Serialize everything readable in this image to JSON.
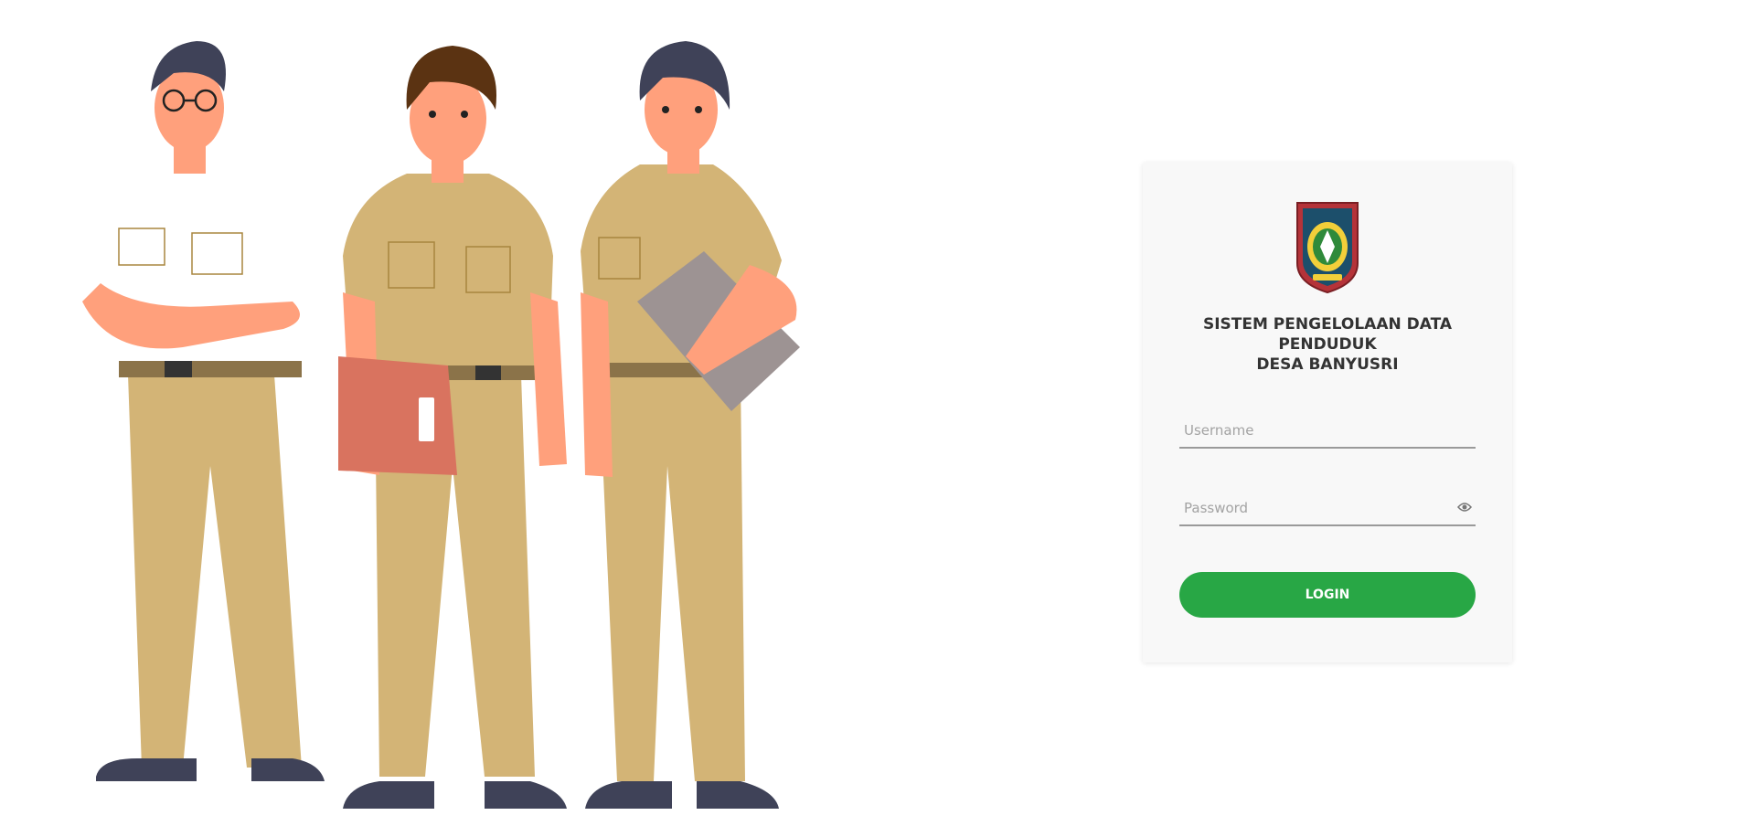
{
  "illustration": {
    "description_icon": "three-civil-servants-illustration"
  },
  "login": {
    "logo_icon": "village-crest-logo",
    "title_line1": "SISTEM PENGELOLAAN DATA",
    "title_line2": "PENDUDUK",
    "title_line3": "DESA BANYUSRI",
    "username_placeholder": "Username",
    "password_placeholder": "Password",
    "eye_icon": "eye-icon",
    "button_label": "LOGIN"
  },
  "colors": {
    "button": "#28a745",
    "card_bg": "#f8f8f8",
    "uniform": "#d3b476",
    "skin": "#ffa07c",
    "hair": "#3f4258"
  }
}
